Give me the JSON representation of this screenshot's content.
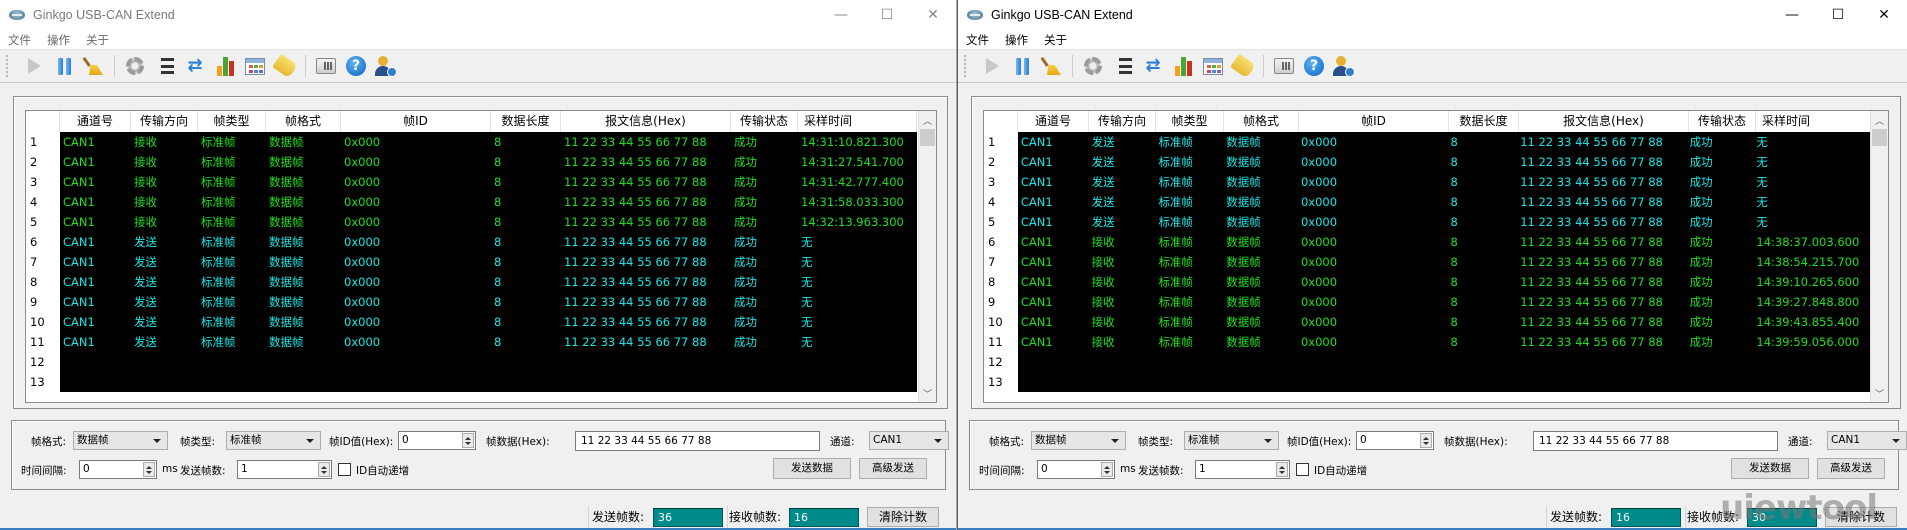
{
  "windows": [
    {
      "title": "Ginkgo USB-CAN Extend",
      "active": false,
      "controls": {
        "minimize": "—",
        "maximize": "☐",
        "close": "✕"
      },
      "menu": [
        "文件",
        "操作",
        "关于"
      ],
      "toolbar": [
        "play-icon",
        "pause-icon",
        "broom-icon",
        "gear-icon",
        "list-icon",
        "refresh-icon",
        "chart-icon",
        "calendar-icon",
        "tag-icon",
        "phone-icon",
        "help-icon",
        "user-info-icon"
      ],
      "columns": [
        "通道号",
        "传输方向",
        "帧类型",
        "帧格式",
        "帧ID",
        "数据长度",
        "报文信息(Hex)",
        "传输状态",
        "采样时间"
      ],
      "rows": [
        {
          "n": "1",
          "dir": "recv",
          "cells": [
            "CAN1",
            "接收",
            "标准帧",
            "数据帧",
            "0x000",
            "8",
            "11 22 33 44 55 66 77 88",
            "成功",
            "14:31:10.821.300"
          ]
        },
        {
          "n": "2",
          "dir": "recv",
          "cells": [
            "CAN1",
            "接收",
            "标准帧",
            "数据帧",
            "0x000",
            "8",
            "11 22 33 44 55 66 77 88",
            "成功",
            "14:31:27.541.700"
          ]
        },
        {
          "n": "3",
          "dir": "recv",
          "cells": [
            "CAN1",
            "接收",
            "标准帧",
            "数据帧",
            "0x000",
            "8",
            "11 22 33 44 55 66 77 88",
            "成功",
            "14:31:42.777.400"
          ]
        },
        {
          "n": "4",
          "dir": "recv",
          "cells": [
            "CAN1",
            "接收",
            "标准帧",
            "数据帧",
            "0x000",
            "8",
            "11 22 33 44 55 66 77 88",
            "成功",
            "14:31:58.033.300"
          ]
        },
        {
          "n": "5",
          "dir": "recv",
          "cells": [
            "CAN1",
            "接收",
            "标准帧",
            "数据帧",
            "0x000",
            "8",
            "11 22 33 44 55 66 77 88",
            "成功",
            "14:32:13.963.300"
          ]
        },
        {
          "n": "6",
          "dir": "send",
          "cells": [
            "CAN1",
            "发送",
            "标准帧",
            "数据帧",
            "0x000",
            "8",
            "11 22 33 44 55 66 77 88",
            "成功",
            "无"
          ]
        },
        {
          "n": "7",
          "dir": "send",
          "cells": [
            "CAN1",
            "发送",
            "标准帧",
            "数据帧",
            "0x000",
            "8",
            "11 22 33 44 55 66 77 88",
            "成功",
            "无"
          ]
        },
        {
          "n": "8",
          "dir": "send",
          "cells": [
            "CAN1",
            "发送",
            "标准帧",
            "数据帧",
            "0x000",
            "8",
            "11 22 33 44 55 66 77 88",
            "成功",
            "无"
          ]
        },
        {
          "n": "9",
          "dir": "send",
          "cells": [
            "CAN1",
            "发送",
            "标准帧",
            "数据帧",
            "0x000",
            "8",
            "11 22 33 44 55 66 77 88",
            "成功",
            "无"
          ]
        },
        {
          "n": "10",
          "dir": "send",
          "cells": [
            "CAN1",
            "发送",
            "标准帧",
            "数据帧",
            "0x000",
            "8",
            "11 22 33 44 55 66 77 88",
            "成功",
            "无"
          ]
        },
        {
          "n": "11",
          "dir": "send",
          "cells": [
            "CAN1",
            "发送",
            "标准帧",
            "数据帧",
            "0x000",
            "8",
            "11 22 33 44 55 66 77 88",
            "成功",
            "无"
          ]
        },
        {
          "n": "12",
          "dir": "empty",
          "cells": [
            "",
            "",
            "",
            "",
            "",
            "",
            "",
            "",
            ""
          ]
        },
        {
          "n": "13",
          "dir": "empty",
          "cells": [
            "",
            "",
            "",
            "",
            "",
            "",
            "",
            "",
            ""
          ]
        }
      ],
      "form": {
        "frame_format_label": "帧格式:",
        "frame_format_value": "数据帧",
        "frame_type_label": "帧类型:",
        "frame_type_value": "标准帧",
        "frame_id_label": "帧ID值(Hex):",
        "frame_id_value": "0",
        "frame_data_label": "帧数据(Hex):",
        "frame_data_value": "11 22 33 44 55 66 77 88",
        "channel_label": "通道:",
        "channel_value": "CAN1",
        "interval_label": "时间间隔:",
        "interval_value": "0",
        "interval_unit": "ms",
        "send_count_label": "发送帧数:",
        "send_count_value": "1",
        "id_auto_inc_label": "ID自动递增",
        "id_auto_inc_checked": false,
        "send_button": "发送数据",
        "advanced_send_button": "高级发送"
      },
      "status": {
        "sent_label": "发送帧数:",
        "sent_value": "36",
        "recv_label": "接收帧数:",
        "recv_value": "16",
        "clear_button": "清除计数"
      }
    },
    {
      "title": "Ginkgo USB-CAN Extend",
      "active": true,
      "controls": {
        "minimize": "—",
        "maximize": "☐",
        "close": "✕"
      },
      "menu": [
        "文件",
        "操作",
        "关于"
      ],
      "toolbar": [
        "play-icon",
        "pause-icon",
        "broom-icon",
        "gear-icon",
        "list-icon",
        "refresh-icon",
        "chart-icon",
        "calendar-icon",
        "tag-icon",
        "phone-icon",
        "help-icon",
        "user-info-icon"
      ],
      "columns": [
        "通道号",
        "传输方向",
        "帧类型",
        "帧格式",
        "帧ID",
        "数据长度",
        "报文信息(Hex)",
        "传输状态",
        "采样时间"
      ],
      "rows": [
        {
          "n": "1",
          "dir": "send",
          "cells": [
            "CAN1",
            "发送",
            "标准帧",
            "数据帧",
            "0x000",
            "8",
            "11 22 33 44 55 66 77 88",
            "成功",
            "无"
          ]
        },
        {
          "n": "2",
          "dir": "send",
          "cells": [
            "CAN1",
            "发送",
            "标准帧",
            "数据帧",
            "0x000",
            "8",
            "11 22 33 44 55 66 77 88",
            "成功",
            "无"
          ]
        },
        {
          "n": "3",
          "dir": "send",
          "cells": [
            "CAN1",
            "发送",
            "标准帧",
            "数据帧",
            "0x000",
            "8",
            "11 22 33 44 55 66 77 88",
            "成功",
            "无"
          ]
        },
        {
          "n": "4",
          "dir": "send",
          "cells": [
            "CAN1",
            "发送",
            "标准帧",
            "数据帧",
            "0x000",
            "8",
            "11 22 33 44 55 66 77 88",
            "成功",
            "无"
          ]
        },
        {
          "n": "5",
          "dir": "send",
          "cells": [
            "CAN1",
            "发送",
            "标准帧",
            "数据帧",
            "0x000",
            "8",
            "11 22 33 44 55 66 77 88",
            "成功",
            "无"
          ]
        },
        {
          "n": "6",
          "dir": "recv",
          "cells": [
            "CAN1",
            "接收",
            "标准帧",
            "数据帧",
            "0x000",
            "8",
            "11 22 33 44 55 66 77 88",
            "成功",
            "14:38:37.003.600"
          ]
        },
        {
          "n": "7",
          "dir": "recv",
          "cells": [
            "CAN1",
            "接收",
            "标准帧",
            "数据帧",
            "0x000",
            "8",
            "11 22 33 44 55 66 77 88",
            "成功",
            "14:38:54.215.700"
          ]
        },
        {
          "n": "8",
          "dir": "recv",
          "cells": [
            "CAN1",
            "接收",
            "标准帧",
            "数据帧",
            "0x000",
            "8",
            "11 22 33 44 55 66 77 88",
            "成功",
            "14:39:10.265.600"
          ]
        },
        {
          "n": "9",
          "dir": "recv",
          "cells": [
            "CAN1",
            "接收",
            "标准帧",
            "数据帧",
            "0x000",
            "8",
            "11 22 33 44 55 66 77 88",
            "成功",
            "14:39:27.848.800"
          ]
        },
        {
          "n": "10",
          "dir": "recv",
          "cells": [
            "CAN1",
            "接收",
            "标准帧",
            "数据帧",
            "0x000",
            "8",
            "11 22 33 44 55 66 77 88",
            "成功",
            "14:39:43.855.400"
          ]
        },
        {
          "n": "11",
          "dir": "recv",
          "cells": [
            "CAN1",
            "接收",
            "标准帧",
            "数据帧",
            "0x000",
            "8",
            "11 22 33 44 55 66 77 88",
            "成功",
            "14:39:59.056.000"
          ]
        },
        {
          "n": "12",
          "dir": "empty",
          "cells": [
            "",
            "",
            "",
            "",
            "",
            "",
            "",
            "",
            ""
          ]
        },
        {
          "n": "13",
          "dir": "empty",
          "cells": [
            "",
            "",
            "",
            "",
            "",
            "",
            "",
            "",
            ""
          ]
        }
      ],
      "form": {
        "frame_format_label": "帧格式:",
        "frame_format_value": "数据帧",
        "frame_type_label": "帧类型:",
        "frame_type_value": "标准帧",
        "frame_id_label": "帧ID值(Hex):",
        "frame_id_value": "0",
        "frame_data_label": "帧数据(Hex):",
        "frame_data_value": "11 22 33 44 55 66 77 88",
        "channel_label": "通道:",
        "channel_value": "CAN1",
        "interval_label": "时间间隔:",
        "interval_value": "0",
        "interval_unit": "ms",
        "send_count_label": "发送帧数:",
        "send_count_value": "1",
        "id_auto_inc_label": "ID自动递增",
        "id_auto_inc_checked": false,
        "send_button": "发送数据",
        "advanced_send_button": "高级发送"
      },
      "status": {
        "sent_label": "发送帧数:",
        "sent_value": "16",
        "recv_label": "接收帧数:",
        "recv_value": "30",
        "clear_button": "清除计数"
      }
    }
  ],
  "watermark": "uiewtool",
  "colors": {
    "recv_text": "#1ee01e",
    "send_text": "#19e6e6",
    "counter_bg": "#008b8b",
    "grid_bg": "#000000"
  }
}
